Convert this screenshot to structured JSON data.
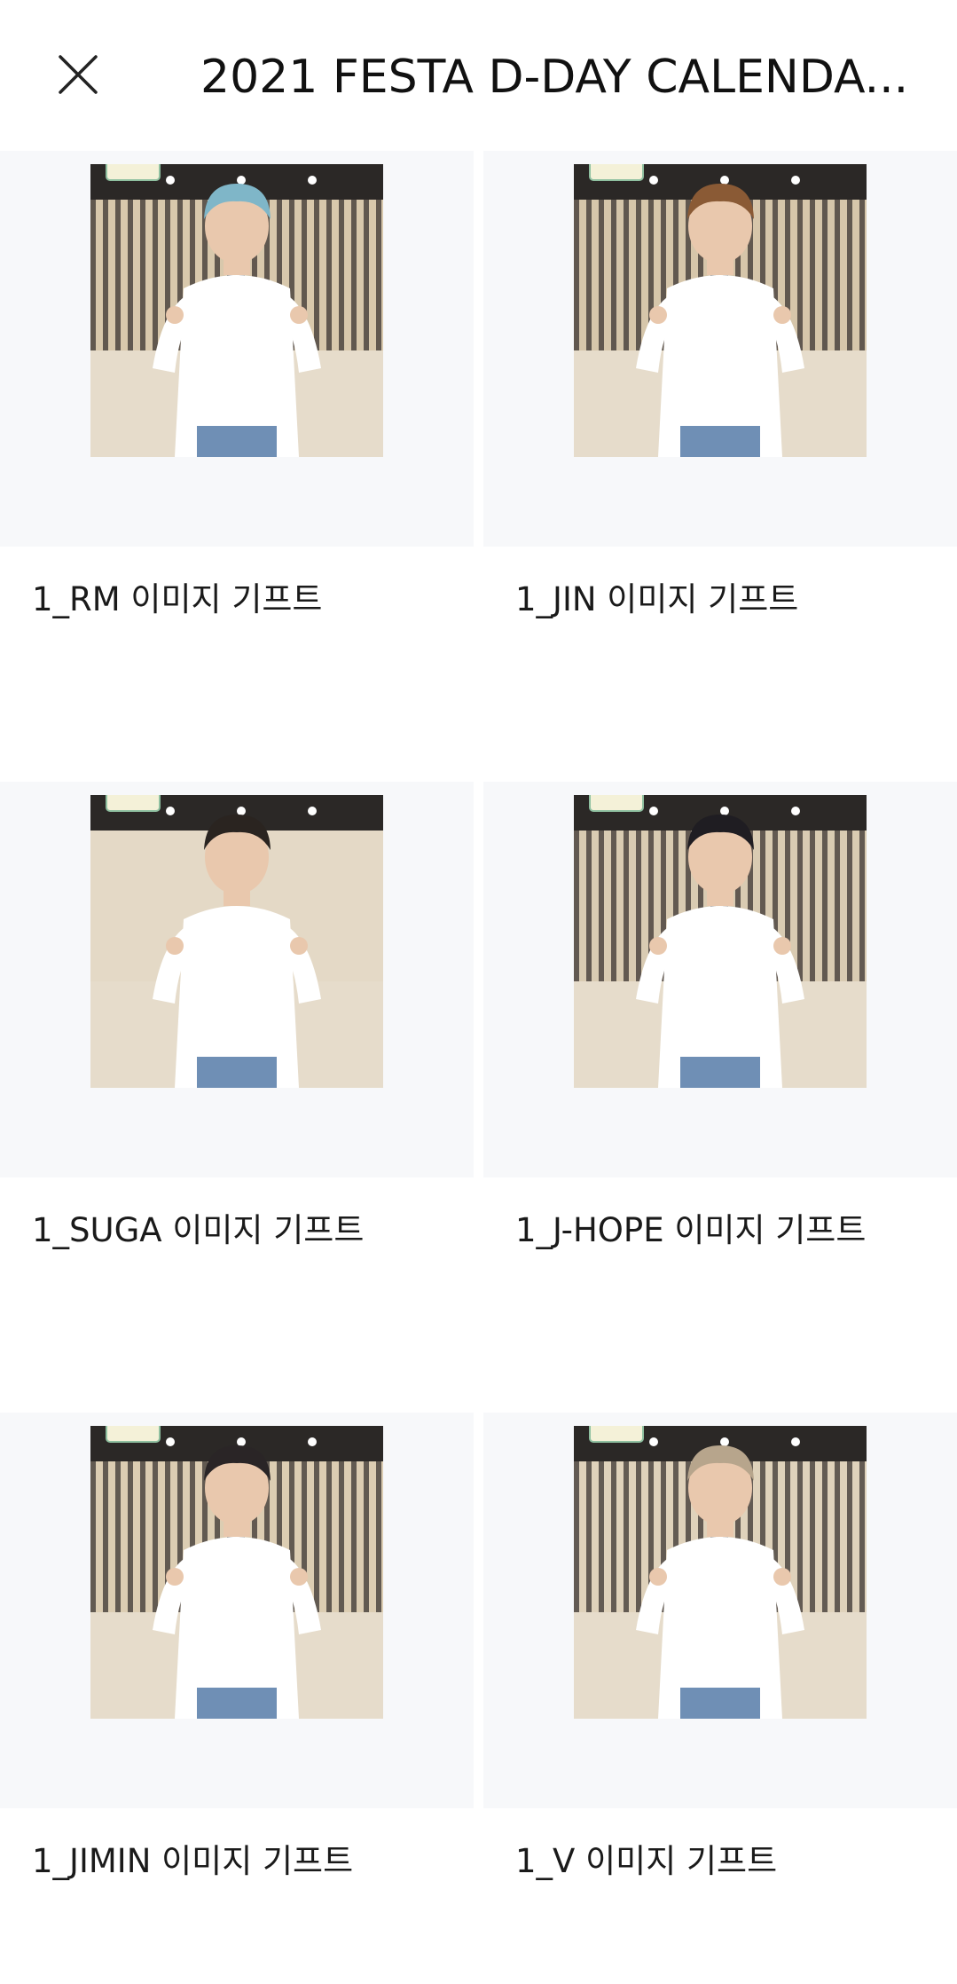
{
  "header": {
    "title": "2021 FESTA D-DAY CALENDA...",
    "close_icon": "close-icon"
  },
  "gifts": [
    {
      "label": "1_RM 이미지 기프트",
      "hair": "#7fb6c8",
      "bg": "#d8c8ac",
      "slats": true
    },
    {
      "label": "1_JIN 이미지 기프트",
      "hair": "#8a5a35",
      "bg": "#d6c6aa",
      "slats": true
    },
    {
      "label": "1_SUGA 이미지 기프트",
      "hair": "#2a2420",
      "bg": "#e4d9c6",
      "slats": false
    },
    {
      "label": "1_J-HOPE 이미지 기프트",
      "hair": "#1f1d22",
      "bg": "#d9cbb2",
      "slats": true
    },
    {
      "label": "1_JIMIN 이미지 기프트",
      "hair": "#2a2526",
      "bg": "#dccdb2",
      "slats": true
    },
    {
      "label": "1_V 이미지 기프트",
      "hair": "#b7a58c",
      "bg": "#dfd2bb",
      "slats": true
    }
  ]
}
